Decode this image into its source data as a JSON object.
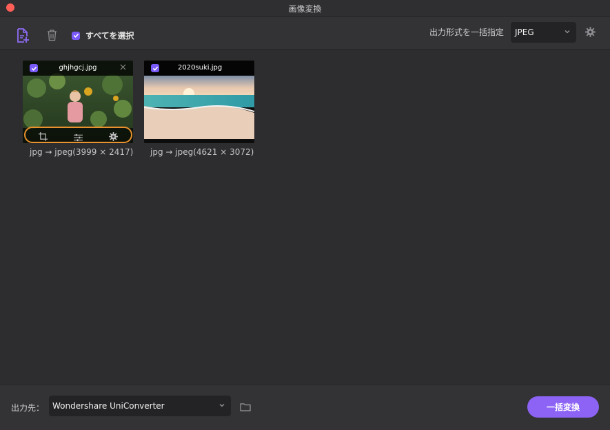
{
  "window": {
    "title": "画像変換"
  },
  "toolbar": {
    "select_all_label": "すべてを選択",
    "format_label": "出力形式を一括指定",
    "format_value": "JPEG"
  },
  "images": [
    {
      "name": "ghjhgcj.jpg",
      "caption": "jpg → jpeg(3999 × 2417)"
    },
    {
      "name": "2020suki.jpg",
      "caption": "jpg → jpeg(4621 × 3072)"
    }
  ],
  "bottom": {
    "output_label": "出力先：",
    "output_value": "Wondershare UniConverter",
    "convert_label": "一括変換"
  },
  "colors": {
    "accent": "#8c63f5",
    "highlight": "#e8912d",
    "close": "#ff5f57"
  }
}
